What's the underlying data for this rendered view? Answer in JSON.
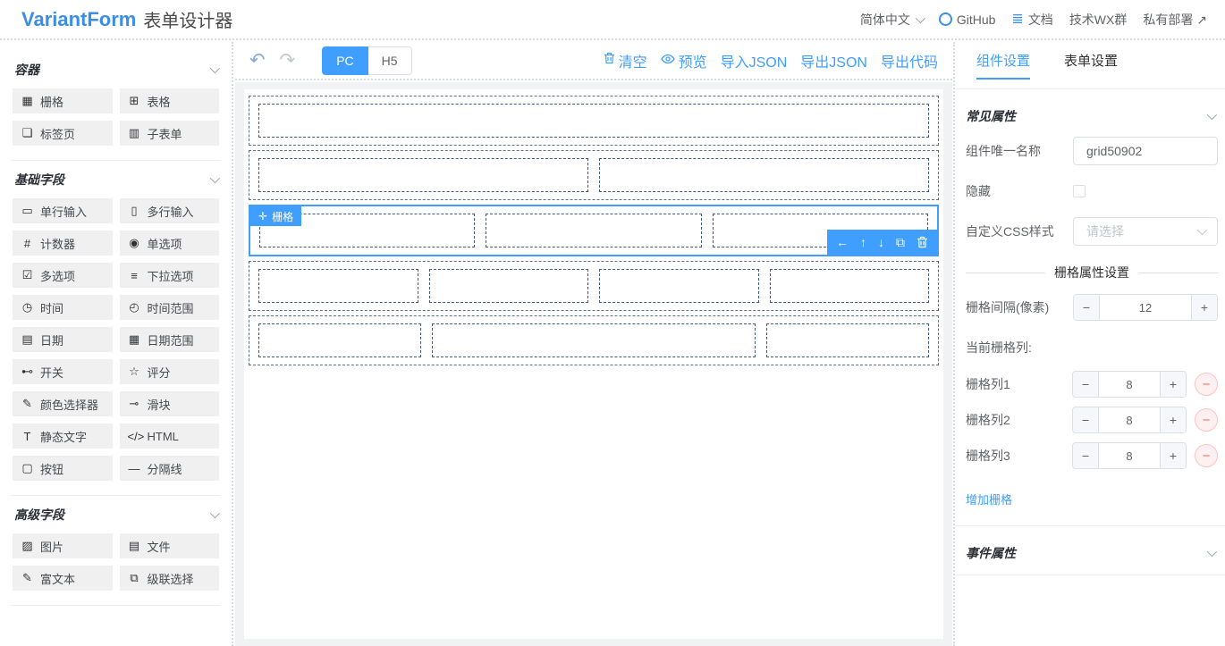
{
  "colors": {
    "primary": "#409eff",
    "danger": "#f56c6c",
    "dashed_border": "#3f5c7e"
  },
  "header": {
    "logo": "VariantForm",
    "title": "表单设计器",
    "language": "简体中文",
    "nav": [
      {
        "label": "GitHub",
        "icon": "github-icon"
      },
      {
        "label": "文档",
        "icon": "docs-icon",
        "glyph": "≣"
      },
      {
        "label": "技术WX群"
      },
      {
        "label": "私有部署",
        "suffix": "↗"
      }
    ]
  },
  "sidebar": {
    "sections": [
      {
        "title": "容器",
        "items": [
          {
            "label": "栅格",
            "icon": "grid-icon",
            "glyph": "▦"
          },
          {
            "label": "表格",
            "icon": "table-icon",
            "glyph": "⊞"
          },
          {
            "label": "标签页",
            "icon": "tab-icon",
            "glyph": "❏"
          },
          {
            "label": "子表单",
            "icon": "subform-icon",
            "glyph": "▥"
          }
        ]
      },
      {
        "title": "基础字段",
        "items": [
          {
            "label": "单行输入",
            "icon": "input-icon",
            "glyph": "▭"
          },
          {
            "label": "多行输入",
            "icon": "textarea-icon",
            "glyph": "▯"
          },
          {
            "label": "计数器",
            "icon": "number-icon",
            "glyph": "#"
          },
          {
            "label": "单选项",
            "icon": "radio-icon",
            "glyph": "◉"
          },
          {
            "label": "多选项",
            "icon": "checkbox-icon",
            "glyph": "☑"
          },
          {
            "label": "下拉选项",
            "icon": "select-icon",
            "glyph": "≡"
          },
          {
            "label": "时间",
            "icon": "time-icon",
            "glyph": "◷"
          },
          {
            "label": "时间范围",
            "icon": "time-range-icon",
            "glyph": "◴"
          },
          {
            "label": "日期",
            "icon": "date-icon",
            "glyph": "▤"
          },
          {
            "label": "日期范围",
            "icon": "date-range-icon",
            "glyph": "▦"
          },
          {
            "label": "开关",
            "icon": "switch-icon",
            "glyph": "⊷"
          },
          {
            "label": "评分",
            "icon": "rate-icon",
            "glyph": "☆"
          },
          {
            "label": "颜色选择器",
            "icon": "color-picker-icon",
            "glyph": "✎"
          },
          {
            "label": "滑块",
            "icon": "slider-icon",
            "glyph": "⊸"
          },
          {
            "label": "静态文字",
            "icon": "static-text-icon",
            "glyph": "T"
          },
          {
            "label": "HTML",
            "icon": "html-icon",
            "glyph": "</>"
          },
          {
            "label": "按钮",
            "icon": "button-icon",
            "glyph": "▢"
          },
          {
            "label": "分隔线",
            "icon": "divider-icon",
            "glyph": "—"
          }
        ]
      },
      {
        "title": "高级字段",
        "items": [
          {
            "label": "图片",
            "icon": "picture-icon",
            "glyph": "▨"
          },
          {
            "label": "文件",
            "icon": "file-icon",
            "glyph": "▤"
          },
          {
            "label": "富文本",
            "icon": "rich-editor-icon",
            "glyph": "✎"
          },
          {
            "label": "级联选择",
            "icon": "cascader-icon",
            "glyph": "⧉"
          }
        ]
      }
    ]
  },
  "toolbar": {
    "undo_icon": "↶",
    "redo_icon": "↷",
    "device_tabs": [
      {
        "label": "PC",
        "active": true
      },
      {
        "label": "H5",
        "active": false
      }
    ],
    "actions": [
      {
        "label": "清空",
        "icon": "trash-icon"
      },
      {
        "label": "预览",
        "icon": "eye-icon"
      },
      {
        "label": "导入JSON"
      },
      {
        "label": "导出JSON"
      },
      {
        "label": "导出代码"
      }
    ]
  },
  "canvas": {
    "selected_widget_tag": "栅格",
    "drag_icon": "✛",
    "action_icons": [
      {
        "icon": "arrow-left-icon",
        "glyph": "←"
      },
      {
        "icon": "arrow-up-icon",
        "glyph": "↑"
      },
      {
        "icon": "arrow-down-icon",
        "glyph": "↓"
      },
      {
        "icon": "copy-icon",
        "glyph": "⧉"
      },
      {
        "icon": "trash-icon",
        "glyph": "svg"
      }
    ],
    "rows": [
      {
        "cols": [
          24
        ],
        "selected": false
      },
      {
        "cols": [
          12,
          12
        ],
        "selected": false
      },
      {
        "cols": [
          8,
          8,
          8
        ],
        "selected": true
      },
      {
        "cols": [
          6,
          6,
          6,
          6
        ],
        "selected": false
      },
      {
        "cols": [
          6,
          12,
          6
        ],
        "selected": false
      }
    ]
  },
  "panel": {
    "tabs": [
      {
        "label": "组件设置",
        "active": true
      },
      {
        "label": "表单设置",
        "active": false
      }
    ],
    "common_section_title": "常见属性",
    "unique_name_label": "组件唯一名称",
    "unique_name_value": "grid50902",
    "hidden_label": "隐藏",
    "hidden_checked": false,
    "css_label": "自定义CSS样式",
    "css_placeholder": "请选择",
    "grid_section_title": "栅格属性设置",
    "gutter_label": "栅格间隔(像素)",
    "gutter_value": "12",
    "current_cols_label": "当前栅格列:",
    "grid_cols": [
      {
        "label": "栅格列1",
        "value": "8"
      },
      {
        "label": "栅格列2",
        "value": "8"
      },
      {
        "label": "栅格列3",
        "value": "8"
      }
    ],
    "add_grid_link": "增加栅格",
    "event_section_title": "事件属性",
    "stepper_minus": "−",
    "stepper_plus": "+"
  }
}
